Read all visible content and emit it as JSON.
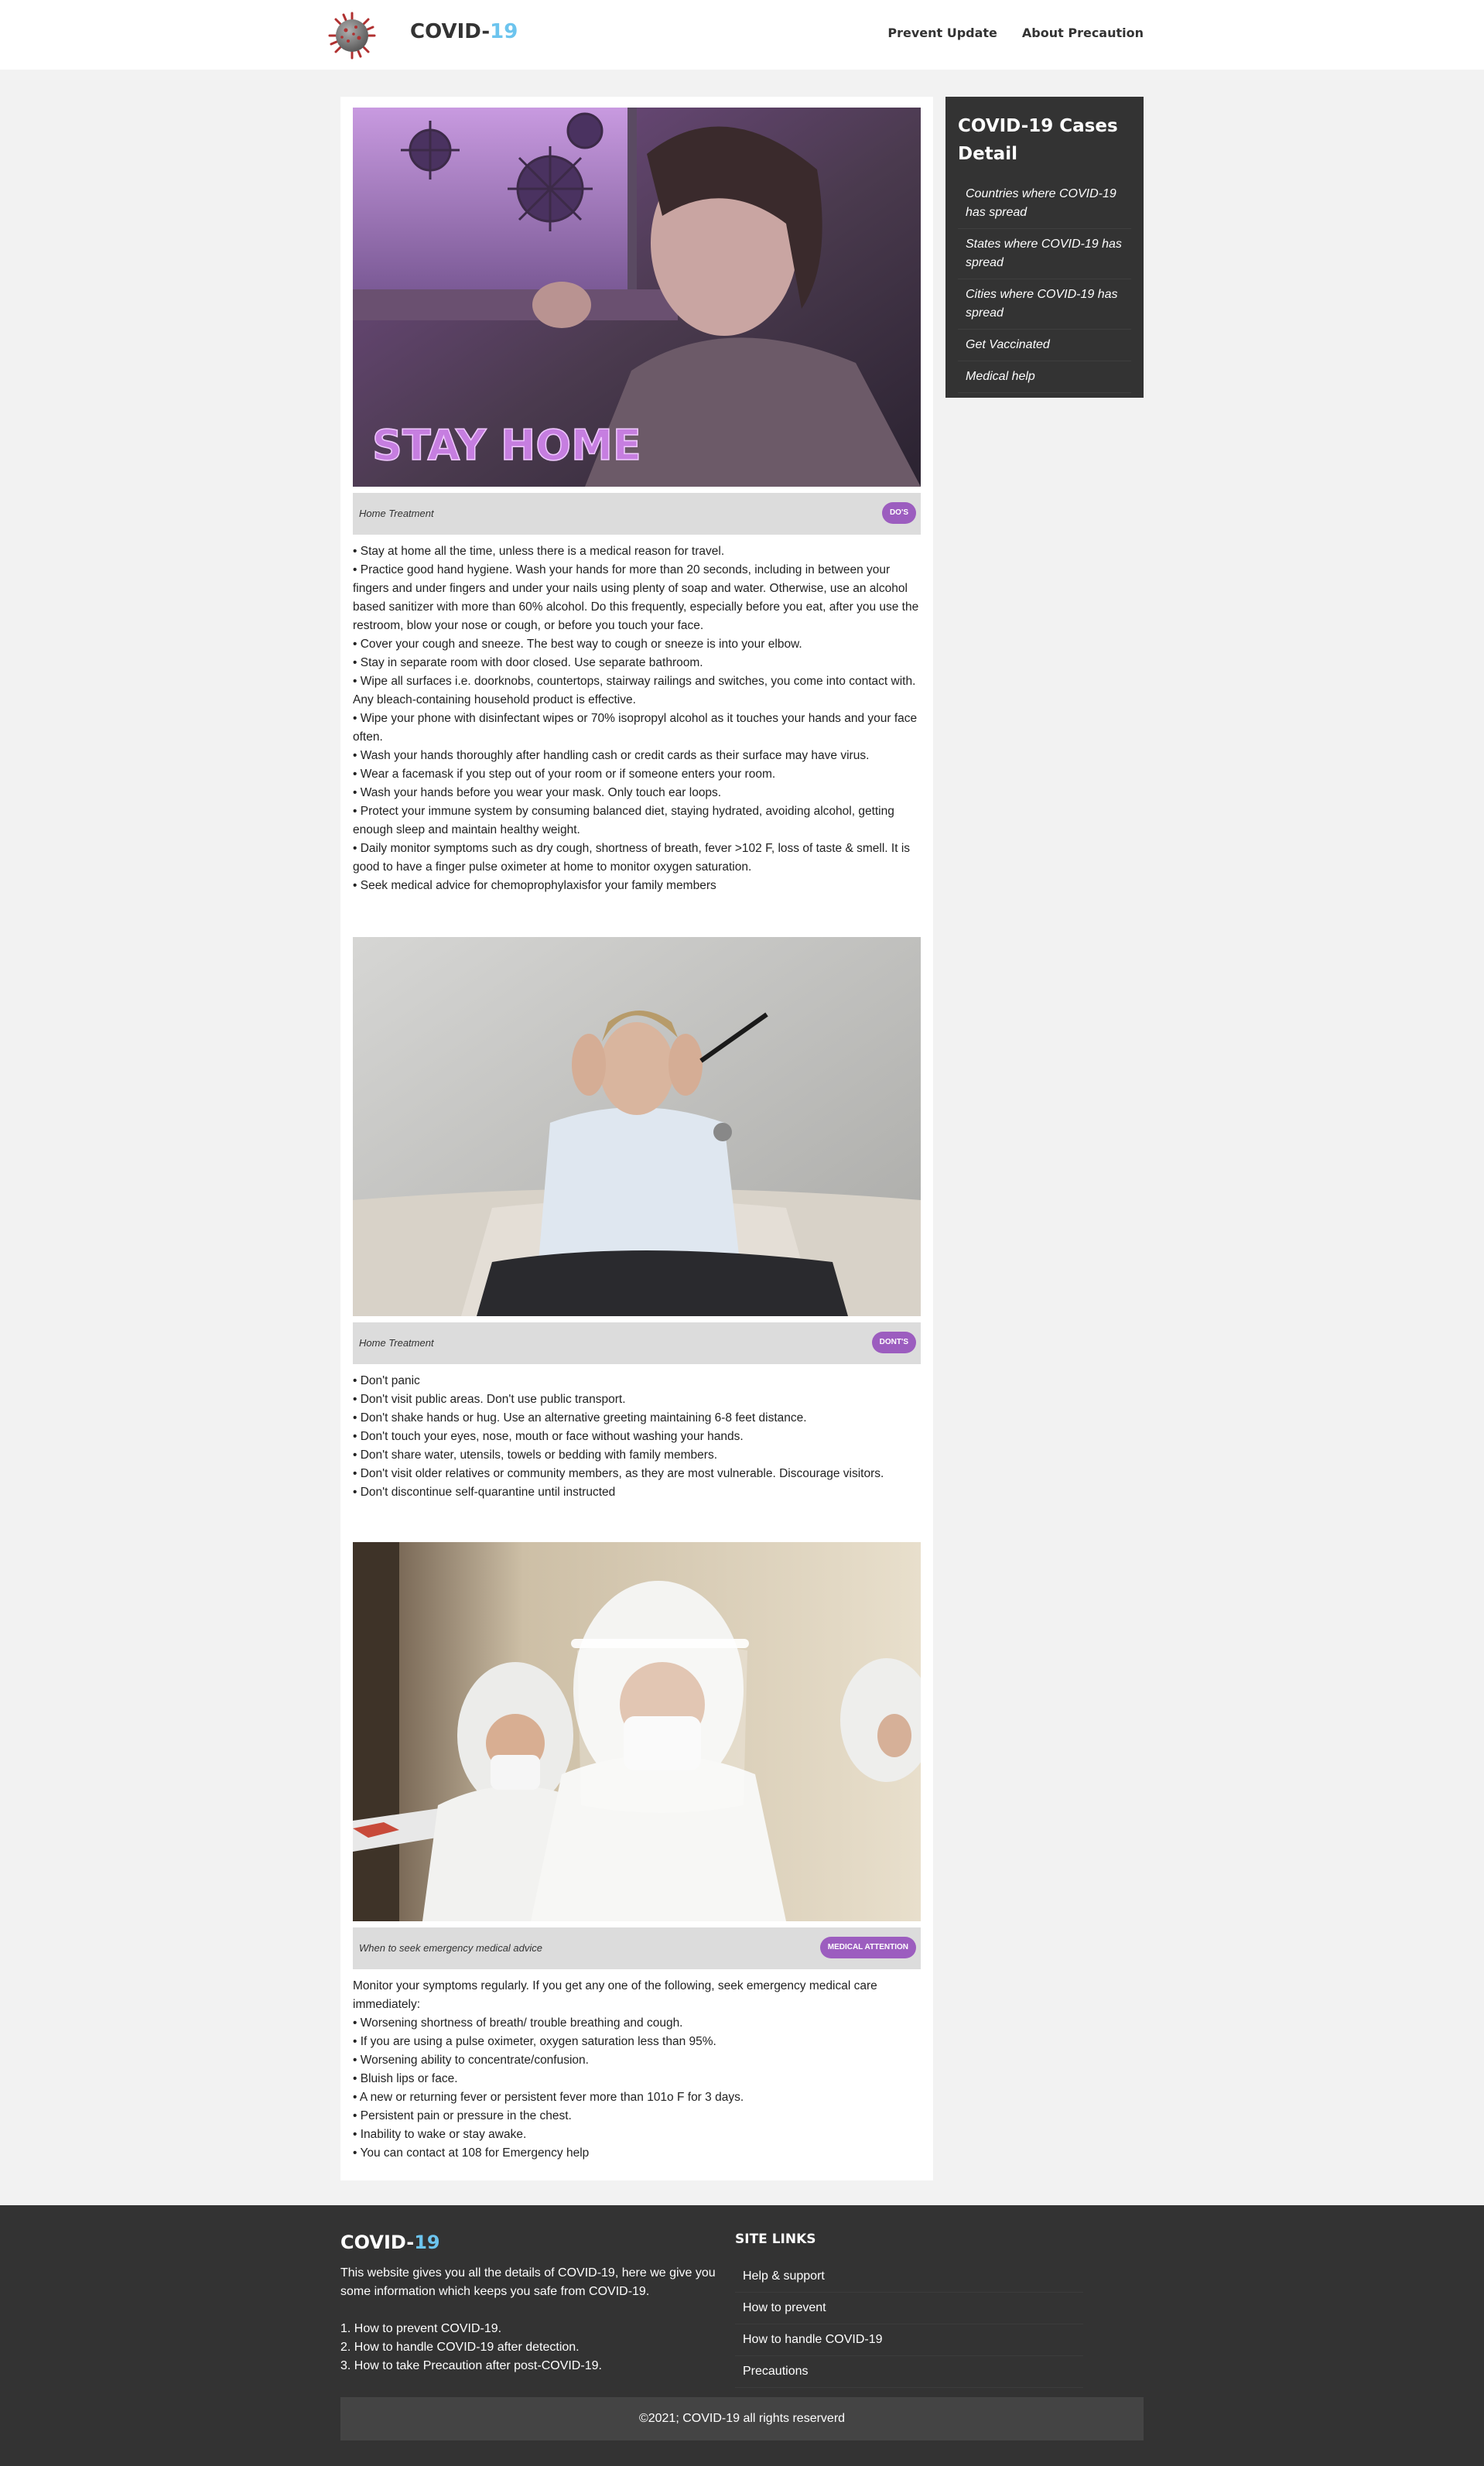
{
  "header": {
    "logo_icon": "coronavirus-icon",
    "brand_main": "COVID-",
    "brand_accent": "19",
    "nav": [
      {
        "label": "Prevent Update"
      },
      {
        "label": "About Precaution"
      }
    ]
  },
  "colors": {
    "accent": "#6cc4ee",
    "badge": "#9c5dbf",
    "dark": "#333333",
    "caption_bar": "#dcdcdc"
  },
  "posts": [
    {
      "image_overlay_text": "STAY HOME",
      "caption": "Home Treatment",
      "badge": "DO'S",
      "lines": [
        "• Stay at home all the time, unless there is a medical reason for travel.",
        "• Practice good hand hygiene. Wash your hands for more than 20 seconds, including in between your fingers and under fingers and under your nails using plenty of soap and water. Otherwise, use an alcohol based sanitizer with more than 60% alcohol. Do this frequently, especially before you eat, after you use the restroom, blow your nose or cough, or before you touch your face.",
        "• Cover your cough and sneeze. The best way to cough or sneeze is into your elbow.",
        "• Stay in separate room with door closed. Use separate bathroom.",
        "• Wipe all surfaces i.e. doorknobs, countertops, stairway railings and switches, you come into contact with. Any bleach-containing household product is effective.",
        "• Wipe your phone with disinfectant wipes or 70% isopropyl alcohol as it touches your hands and your face often.",
        "• Wash your hands thoroughly after handling cash or credit cards as their surface may have virus.",
        "• Wear a facemask if you step out of your room or if someone enters your room.",
        "• Wash your hands before you wear your mask. Only touch ear loops.",
        "• Protect your immune system by consuming balanced diet, staying hydrated, avoiding alcohol, getting enough sleep and maintain healthy weight.",
        "• Daily monitor symptoms such as dry cough, shortness of breath, fever >102 F, loss of taste & smell. It is good to have a finger pulse oximeter at home to monitor oxygen saturation.",
        "• Seek medical advice for chemoprophylaxisfor your family members"
      ]
    },
    {
      "caption": "Home Treatment",
      "badge": "DONT'S",
      "lines": [
        "• Don't panic",
        "• Don't visit public areas. Don't use public transport.",
        "• Don't shake hands or hug. Use an alternative greeting maintaining 6-8 feet distance.",
        "• Don't touch your eyes, nose, mouth or face without washing your hands.",
        "• Don't share water, utensils, towels or bedding with family members.",
        "• Don't visit older relatives or community members, as they are most vulnerable. Discourage visitors.",
        "• Don't discontinue self-quarantine until instructed"
      ]
    },
    {
      "caption": "When to seek emergency medical advice",
      "badge": "MEDICAL ATTENTION",
      "lines": [
        "Monitor your symptoms regularly. If you get any one of the following, seek emergency medical care immediately:",
        "• Worsening shortness of breath/ trouble breathing and cough.",
        "• If you are using a pulse oximeter, oxygen saturation less than 95%.",
        "• Worsening ability to concentrate/confusion.",
        "• Bluish lips or face.",
        "• A new or returning fever or persistent fever more than 101o F for 3 days.",
        "• Persistent pain or pressure in the chest.",
        "• Inability to wake or stay awake.",
        "• You can contact at 108 for Emergency help"
      ]
    }
  ],
  "sidebar": {
    "title": "COVID-19 Cases Detail",
    "items": [
      {
        "label": "Countries where COVID-19 has spread"
      },
      {
        "label": "States where COVID-19 has spread"
      },
      {
        "label": "Cities where COVID-19 has spread"
      },
      {
        "label": "Get Vaccinated"
      },
      {
        "label": "Medical help"
      }
    ]
  },
  "footer": {
    "brand_main": "COVID-",
    "brand_accent": "19",
    "description": "This website gives you all the details of COVID-19, here we give you some information which keeps you safe from COVID-19.",
    "list": [
      "1. How to prevent COVID-19.",
      "2. How to handle COVID-19 after detection.",
      "3. How to take Precaution after post-COVID-19."
    ],
    "links_title": "SITE LINKS",
    "links": [
      {
        "label": "Help & support"
      },
      {
        "label": "How to prevent"
      },
      {
        "label": "How to handle COVID-19"
      },
      {
        "label": "Precautions"
      }
    ],
    "copyright": "©2021; COVID-19 all rights reserverd"
  }
}
